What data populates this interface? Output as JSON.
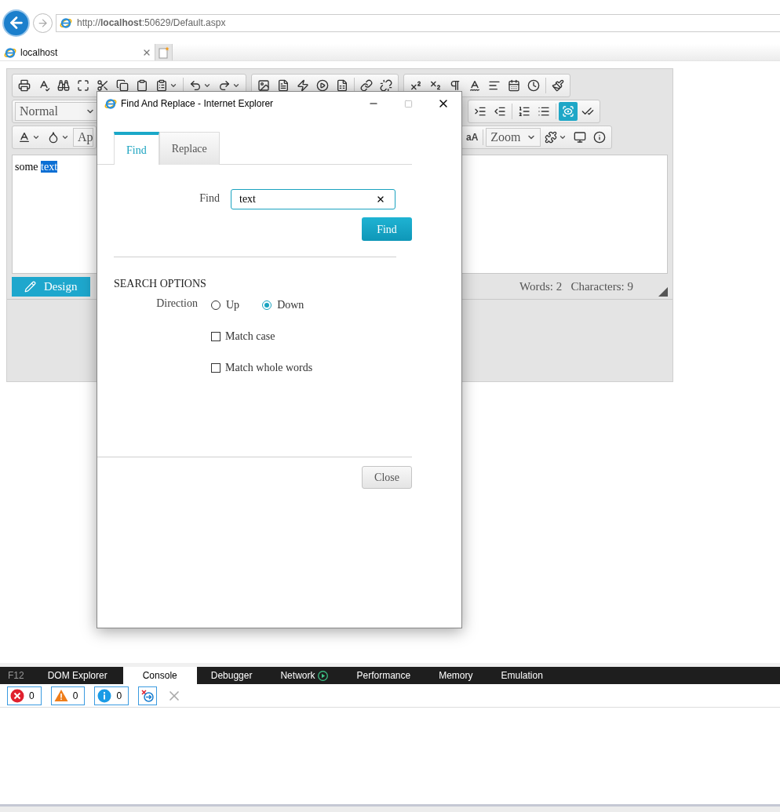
{
  "browser": {
    "address": "http://**localhost**:50629/Default.aspx",
    "tab": {
      "title": "localhost"
    }
  },
  "editor": {
    "toolbar": [
      [
        {
          "kind": "icon",
          "selected": false
        },
        {
          "kind": "icon",
          "selected": false
        },
        {
          "kind": "icon",
          "selected": false
        },
        {
          "kind": "icon",
          "selected": false
        },
        {
          "kind": "icon",
          "selected": false
        },
        {
          "kind": "icon",
          "selected": false
        },
        {
          "kind": "icon",
          "selected": false
        },
        {
          "kind": "split",
          "selected": false
        },
        {
          "kind": "separator"
        },
        {
          "kind": "split",
          "selected": false
        },
        {
          "kind": "split",
          "selected": false
        },
        {
          "kind": "group"
        },
        {
          "kind": "icon",
          "selected": false
        },
        {
          "kind": "icon",
          "selected": false
        },
        {
          "kind": "icon",
          "selected": false
        },
        {
          "kind": "icon",
          "selected": false
        },
        {
          "kind": "icon",
          "selected": false
        },
        {
          "kind": "separator"
        },
        {
          "kind": "icon",
          "selected": false
        },
        {
          "kind": "icon",
          "selected": false
        },
        {
          "kind": "group"
        },
        {
          "kind": "icon",
          "selected": false
        },
        {
          "kind": "icon",
          "selected": false
        },
        {
          "kind": "icon",
          "selected": false
        },
        {
          "kind": "icon",
          "selected": false
        },
        {
          "kind": "icon",
          "selected": false
        },
        {
          "kind": "icon",
          "selected": false
        },
        {
          "kind": "icon",
          "selected": false
        },
        {
          "kind": "separator"
        },
        {
          "kind": "icon",
          "selected": false
        }
      ],
      [
        {
          "kind": "select",
          "label": "Normal"
        },
        {
          "kind": "gap"
        },
        {
          "kind": "icon",
          "selected": false
        },
        {
          "kind": "icon",
          "selected": false
        },
        {
          "kind": "separator"
        },
        {
          "kind": "icon",
          "selected": false
        },
        {
          "kind": "icon",
          "selected": false
        },
        {
          "kind": "separator"
        },
        {
          "kind": "icon",
          "selected": true
        },
        {
          "kind": "icon",
          "selected": false
        }
      ],
      [
        {
          "kind": "split",
          "selected": false
        },
        {
          "kind": "split",
          "selected": false
        },
        {
          "kind": "select",
          "label": "Ap"
        },
        {
          "kind": "gap"
        },
        {
          "kind": "label",
          "label": "aA"
        },
        {
          "kind": "separator"
        },
        {
          "kind": "select",
          "label": "Zoom"
        },
        {
          "kind": "split",
          "selected": false
        },
        {
          "kind": "icon",
          "selected": false
        },
        {
          "kind": "icon",
          "selected": false
        }
      ]
    ],
    "content": [
      {
        "text": "some ",
        "selected": false
      },
      {
        "text": "text",
        "selected": true
      }
    ],
    "mode_button": "Design",
    "stats": "Words: 2   Characters: 9"
  },
  "dialog": {
    "title": "Find And Replace - Internet Explorer",
    "tabs": [
      {
        "label": "Find",
        "selected": true
      },
      {
        "label": "Replace",
        "selected": false
      }
    ],
    "find_label": "Find",
    "find_value": "text",
    "find_button": "Find",
    "section_title": "SEARCH OPTIONS",
    "direction_label": "Direction",
    "directions": [
      {
        "label": "Up",
        "selected": false
      },
      {
        "label": "Down",
        "selected": true
      }
    ],
    "options": [
      {
        "label": "Match case",
        "checked": false
      },
      {
        "label": "Match whole words",
        "checked": false
      }
    ],
    "close_button": "Close"
  },
  "devtools": {
    "tabs": [
      {
        "label": "F12",
        "kind": "label",
        "selected": false
      },
      {
        "label": "DOM Explorer",
        "kind": "tab",
        "selected": false
      },
      {
        "label": "Console",
        "kind": "tab",
        "selected": true
      },
      {
        "label": "Debugger",
        "kind": "tab",
        "selected": false
      },
      {
        "label": "Network",
        "kind": "tab-play",
        "selected": false
      },
      {
        "label": "Performance",
        "kind": "tab",
        "selected": false
      },
      {
        "label": "Memory",
        "kind": "tab",
        "selected": false
      },
      {
        "label": "Emulation",
        "kind": "tab",
        "selected": false
      }
    ],
    "counters": [
      {
        "kind": "error",
        "count": "0"
      },
      {
        "kind": "warning",
        "count": "0"
      },
      {
        "kind": "info",
        "count": "0"
      }
    ]
  }
}
